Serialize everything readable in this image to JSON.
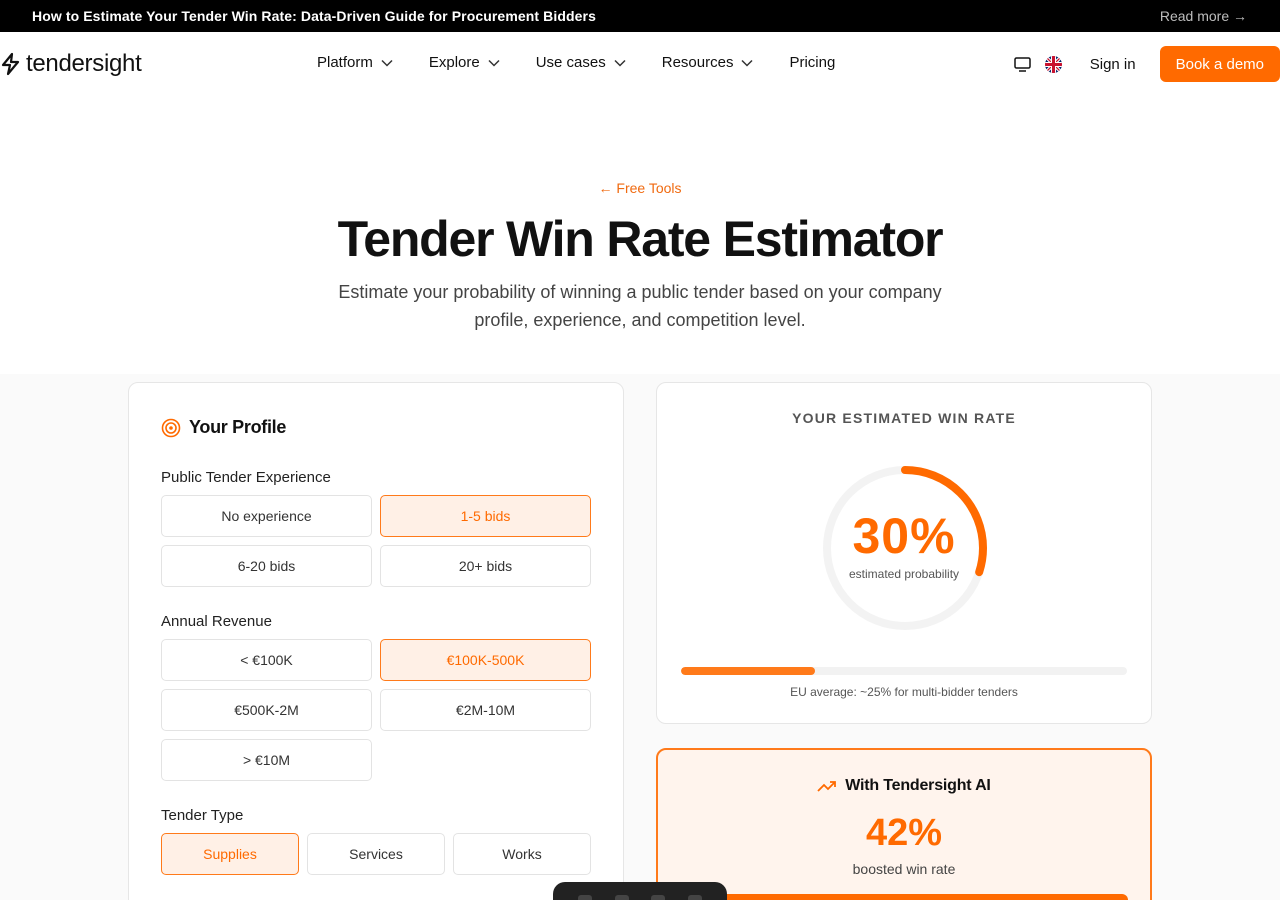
{
  "announcement": {
    "text": "How to Estimate Your Tender Win Rate: Data-Driven Guide for Procurement Bidders",
    "link": "Read more →"
  },
  "nav": {
    "brand": "tendersight",
    "items": [
      {
        "label": "Platform"
      },
      {
        "label": "Explore"
      },
      {
        "label": "Use cases"
      },
      {
        "label": "Resources"
      },
      {
        "label": "Pricing"
      }
    ],
    "signin": "Sign in",
    "demo": "Book a demo"
  },
  "hero": {
    "back": "← Free Tools",
    "title": "Tender Win Rate Estimator",
    "subtitle": "Estimate your probability of winning a public tender based on your company profile, experience, and competition level."
  },
  "profile": {
    "heading": "Your Profile",
    "experience": {
      "label": "Public Tender Experience",
      "options": [
        "No experience",
        "1-5 bids",
        "6-20 bids",
        "20+ bids"
      ],
      "selected": "1-5 bids"
    },
    "revenue": {
      "label": "Annual Revenue",
      "options": [
        "< €100K",
        "€100K-500K",
        "€500K-2M",
        "€2M-10M",
        "> €10M"
      ],
      "selected": "€100K-500K"
    },
    "tender_type": {
      "label": "Tender Type",
      "options": [
        "Supplies",
        "Services",
        "Works"
      ],
      "selected": "Supplies"
    }
  },
  "result": {
    "label": "YOUR ESTIMATED WIN RATE",
    "value": "30%",
    "value_num": 30,
    "caption": "estimated probability",
    "progress": 0.3,
    "note": "EU average: ~25% for multi-bidder tenders"
  },
  "boost": {
    "heading": "With Tendersight AI",
    "value": "42%",
    "caption": "boosted win rate"
  },
  "colors": {
    "accent": "#ff6a00",
    "accent_light": "#fff0e6"
  }
}
